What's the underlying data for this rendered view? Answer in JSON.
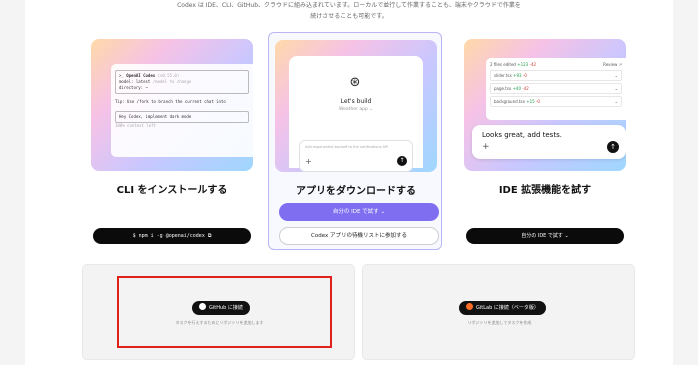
{
  "intro": {
    "line1": "Codex は IDE、CLI、GitHub、クラウドに組み込まれています。ローカルで並行して作業することも、端末やクラウドで作業を",
    "line2": "続けさせることも可能です。"
  },
  "cards": [
    {
      "title": "CLI をインストールする",
      "terminal": {
        "header_name": "OpenAI Codex",
        "header_version": "(v0.55.0)",
        "model_label": "model:",
        "model_value": "latest",
        "model_hint": "/model to change",
        "dir_label": "directory:",
        "dir_value": "~",
        "tip": "Tip: Use /fork to branch the current chat into",
        "input": "Hey Codex, implement dark mode",
        "ctx": "100% context left"
      },
      "button": {
        "label": "$ npm i -g @openai/codex"
      }
    },
    {
      "title": "アプリをダウンロードする",
      "app": {
        "build": "Let's build",
        "workspace": "Weather app ⌄",
        "placeholder": "Add exponential backoff to the notifications API"
      },
      "primary_button": "自分の IDE で試す ⌄",
      "secondary_button": "Codex アプリの待機リストに参加する"
    },
    {
      "title": "IDE 拡張機能を試す",
      "diff": {
        "summary": "2 files edited",
        "summary_add": "+123",
        "summary_del": "-42",
        "review": "Review ↗",
        "files": [
          {
            "name": "slider.tsx",
            "add": "+93",
            "del": "-0"
          },
          {
            "name": "page.tsx",
            "add": "+40",
            "del": "-42"
          },
          {
            "name": "background.tsx",
            "add": "+15",
            "del": "-0"
          }
        ]
      },
      "chat": "Looks great, add tests.",
      "button": {
        "label": "自分の IDE で試す ⌄"
      }
    }
  ],
  "github": {
    "button": "GitHub に接続",
    "sub": "タスクを行えするためにリポジトリを追加します"
  },
  "gitlab": {
    "button": "GitLab に接続（ベータ版）",
    "sub": "リポジトリを追加してタスクを作成"
  }
}
